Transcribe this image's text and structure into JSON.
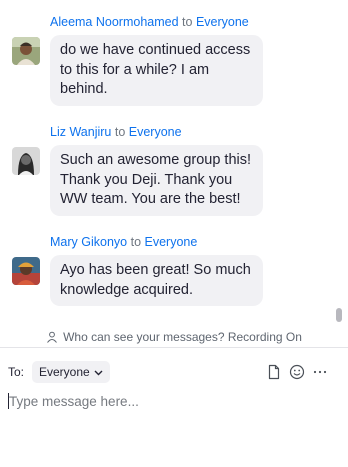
{
  "messages": [
    {
      "sender": "Aleema Noormohamed",
      "to_word": "to",
      "recipient": "Everyone",
      "lines": [
        "do we have continued access",
        "to this for a while? I am",
        "behind."
      ]
    },
    {
      "sender": "Liz Wanjiru",
      "to_word": "to",
      "recipient": "Everyone",
      "lines": [
        "Such an awesome group this!",
        "Thank you Deji. Thank you",
        "WW team. You are the best!"
      ]
    },
    {
      "sender": "Mary Gikonyo",
      "to_word": "to",
      "recipient": "Everyone",
      "lines": [
        "Ayo has been great! So much",
        "knowledge acquired."
      ]
    }
  ],
  "notice": {
    "icon": "person-icon",
    "text": "Who can see your messages? Recording On"
  },
  "compose": {
    "to_label": "To:",
    "recipient": "Everyone",
    "placeholder": "Type message here...",
    "icons": [
      "file-icon",
      "emoji-icon",
      "more-icon"
    ]
  },
  "colors": {
    "link": "#0e72ed",
    "bubble": "#f1f1f4",
    "text": "#232333",
    "muted": "#6e7680"
  }
}
